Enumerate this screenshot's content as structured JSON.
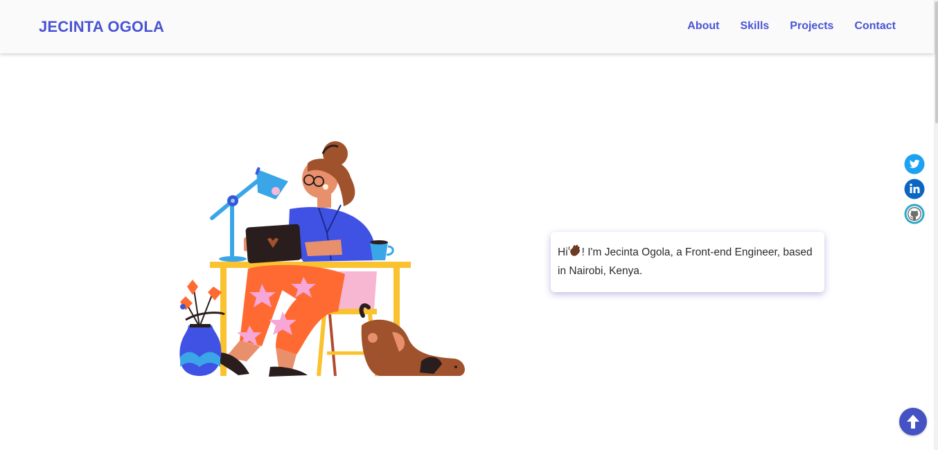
{
  "nav": {
    "brand": "JECINTA OGOLA",
    "links": [
      "About",
      "Skills",
      "Projects",
      "Contact"
    ]
  },
  "hero": {
    "greeting": "Hi",
    "greeting_emoji": "waving-hand-icon",
    "bio_text": "! I'm Jecinta Ogola, a Front-end Engineer, based in Nairobi, Kenya."
  },
  "socials": [
    {
      "icon": "twitter-icon",
      "color": "#1da1f2"
    },
    {
      "icon": "linkedin-icon",
      "color": "#0a66c2"
    },
    {
      "icon": "github-icon",
      "color": "#2aa9c8"
    }
  ],
  "back_to_top": {
    "icon": "arrow-up-icon",
    "color": "#4552c3"
  },
  "colors": {
    "accent": "#4a53d4"
  }
}
